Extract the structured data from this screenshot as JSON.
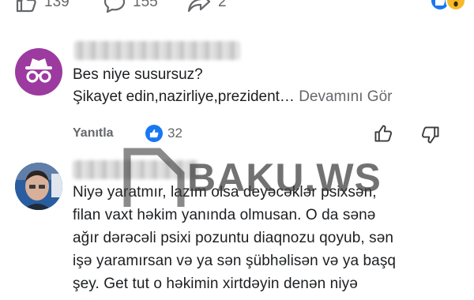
{
  "post_actions": {
    "likes": "139",
    "comments": "155",
    "shares": "2"
  },
  "reactions": [
    "like-reaction-icon",
    "wow-reaction-icon"
  ],
  "comments": [
    {
      "lines": [
        "Bes niye susursuz?",
        "Şikayet edin,nazirliye,prezident…"
      ],
      "more_label": "Devamını Gör",
      "reply_label": "Yanıtla",
      "like_count": "32"
    },
    {
      "lines": [
        "Niyə yaratmır, lazım olsa deyəcəklər psixsən,",
        "filan vaxt həkim yanında olmusan. O da sənə",
        "ağır dərəcəli psixi pozuntu diaqnozu qoyub, sən",
        "işə yaramırsan və ya sən şübhəlisən və ya başq",
        "şey. Get tut o həkimin xirtdəyin denən niyə"
      ]
    }
  ],
  "watermark": "BAKU.WS",
  "colors": {
    "facebook_blue": "#1877f2",
    "muted_text": "#65676b",
    "avatar_purple": "#9c3aa0"
  }
}
